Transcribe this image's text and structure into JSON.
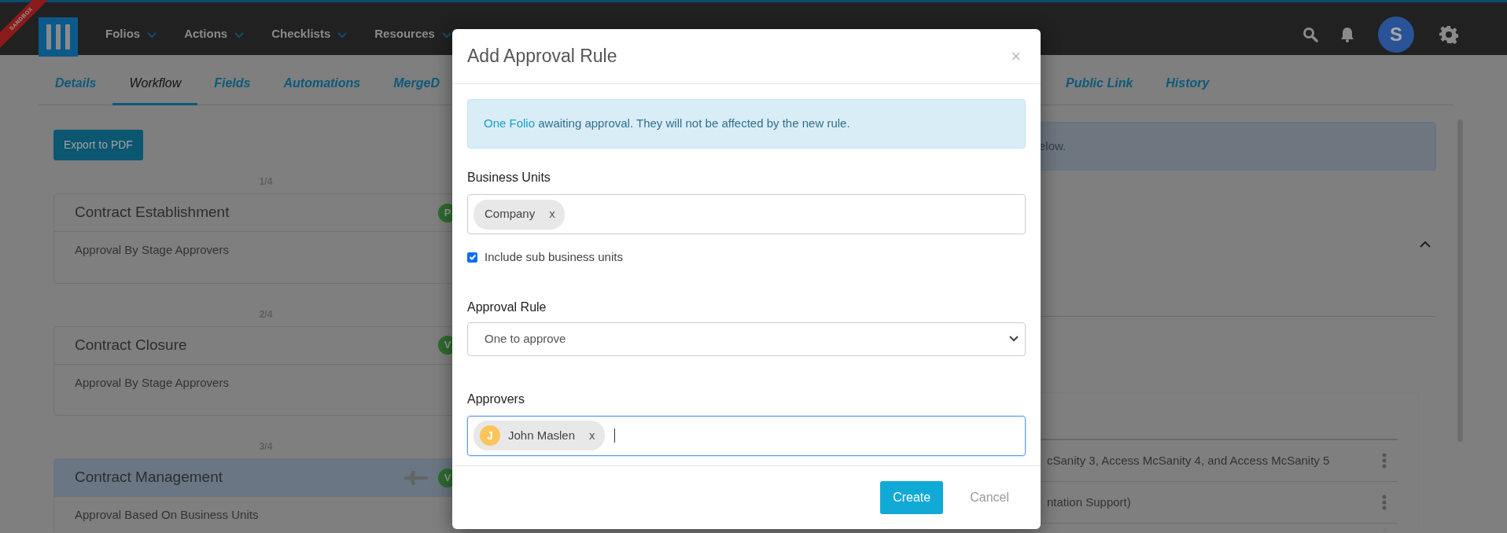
{
  "environment_ribbon": "SANDBOX",
  "navbar": {
    "menus": [
      {
        "label": "Folios"
      },
      {
        "label": "Actions"
      },
      {
        "label": "Checklists"
      },
      {
        "label": "Resources"
      }
    ],
    "avatar_initial": "S"
  },
  "tabs": [
    {
      "label": "Details",
      "selected": false
    },
    {
      "label": "Workflow",
      "selected": true
    },
    {
      "label": "Fields",
      "selected": false
    },
    {
      "label": "Automations",
      "selected": false
    },
    {
      "label": "MergeD",
      "selected": false
    },
    {
      "label": "Public Link",
      "selected": false
    },
    {
      "label": "History",
      "selected": false
    }
  ],
  "export_button": "Export to PDF",
  "stages": [
    {
      "counter": "1/4",
      "title": "Contract Establishment",
      "badge": "P",
      "rule": "Approval By Stage Approvers",
      "highlighted": false,
      "kind": "plain"
    },
    {
      "counter": "2/4",
      "title": "Contract Closure",
      "badge": "V",
      "rule": "Approval By Stage Approvers",
      "highlighted": false,
      "kind": "plain"
    },
    {
      "counter": "3/4",
      "title": "Contract Management",
      "badge": "V",
      "rule": "Approval Based On Business Units",
      "highlighted": true,
      "kind": "plane"
    }
  ],
  "right_panel": {
    "alert_text": "elow.",
    "expanded": true,
    "rows": [
      {
        "text": "cSanity 3, Access McSanity 4, and Access McSanity 5",
        "menu": true
      },
      {
        "text": "ntation Support)",
        "menu": true
      },
      {
        "menu": true
      }
    ]
  },
  "modal": {
    "title": "Add Approval Rule",
    "close": "×",
    "alert": {
      "link": "One Folio",
      "text": " awaiting approval. They will not be affected by the new rule."
    },
    "business_units": {
      "label": "Business Units",
      "chips": [
        {
          "name": "Company",
          "remove": "x"
        }
      ]
    },
    "include_sub": {
      "label": "Include sub business units",
      "checked": true
    },
    "approval_rule": {
      "label": "Approval Rule",
      "value": "One to approve"
    },
    "approvers": {
      "label": "Approvers",
      "focused": true,
      "chips": [
        {
          "initial": "J",
          "name": "John Maslen",
          "remove": "x"
        }
      ]
    },
    "buttons": {
      "create": "Create",
      "cancel": "Cancel"
    }
  }
}
